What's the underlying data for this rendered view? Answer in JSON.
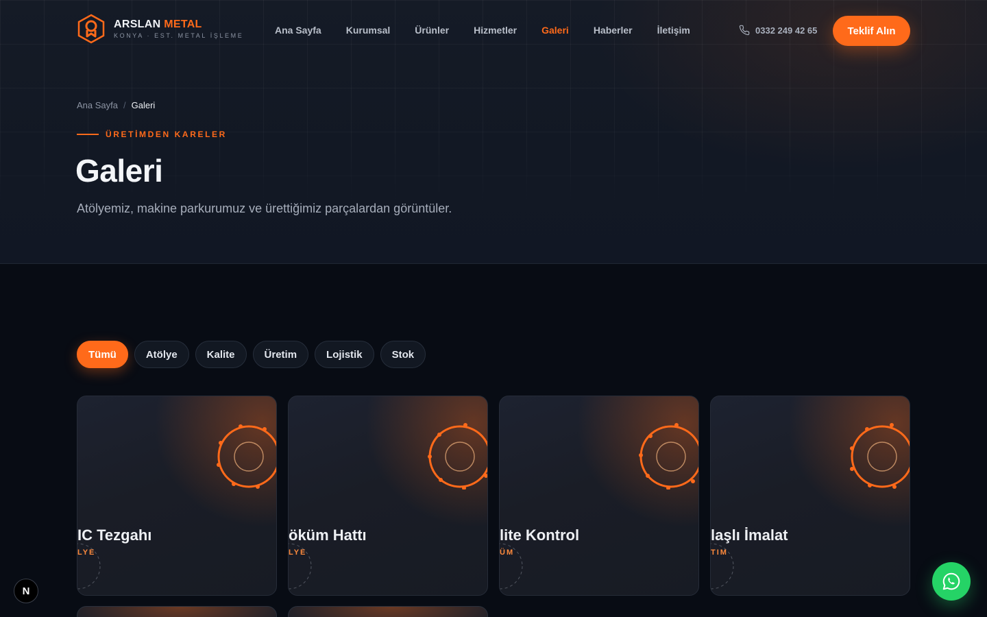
{
  "brand": {
    "name_part1": "ARSLAN",
    "name_part2": "METAL",
    "tagline": "KONYA · EST. METAL İŞLEME"
  },
  "nav": {
    "items": [
      "Ana Sayfa",
      "Kurumsal",
      "Ürünler",
      "Hizmetler",
      "Galeri",
      "Haberler",
      "İletişim"
    ],
    "active": "Galeri"
  },
  "header": {
    "phone": "0332 249 42 65",
    "cta_label": "Teklif Alın"
  },
  "breadcrumb": {
    "home": "Ana Sayfa",
    "separator": "/",
    "current": "Galeri"
  },
  "hero": {
    "eyebrow": "ÜRETİMDEN KARELER",
    "title": "Galeri",
    "subtitle": "Atölyemiz, makine parkurumuz ve ürettiğimiz parçalardan görüntüler."
  },
  "filters": {
    "items": [
      "Tümü",
      "Atölye",
      "Kalite",
      "Üretim",
      "Lojistik",
      "Stok"
    ],
    "active": "Tümü"
  },
  "gallery": {
    "cards": [
      {
        "title_visible": "IC Tezgahı",
        "category_visible": "LYE"
      },
      {
        "title_visible": "öküm Hattı",
        "category_visible": "LYE"
      },
      {
        "title_visible": "lite Kontrol",
        "category_visible": "ÜM"
      },
      {
        "title_visible": "laşlı İmalat",
        "category_visible": "TIM"
      }
    ]
  },
  "floating": {
    "next_badge": "N",
    "whatsapp_icon": "whatsapp-icon"
  },
  "colors": {
    "accent": "#ff6a1a",
    "background": "#080c14",
    "hero_bg": "#141a25",
    "whatsapp": "#25d366"
  }
}
